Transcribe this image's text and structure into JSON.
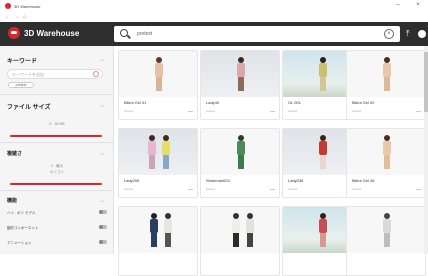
{
  "window": {
    "title": "3D Warehouse",
    "nav_back": "←",
    "nav_forward": "→",
    "nav_home": "⌂",
    "minimize": "–",
    "close": "×"
  },
  "header": {
    "brand": "3D Warehouse",
    "search_value": "pretext",
    "clear": "×",
    "upload_icon": "⤒"
  },
  "sidebar": {
    "keyword_heading": "キーワード",
    "keyword_placeholder": "キーワードを追加",
    "keyword_chip": "pretext",
    "filesize_heading": "ファイル サイズ",
    "filesize_range": "0 - 30 MB",
    "complexity_heading": "複雑さ",
    "complexity_line1": "0 - 最大",
    "complexity_line2": "ポリゴン",
    "features_heading": "機能",
    "toggles": [
      "ハイ - ポリ モデル",
      "動的コンポーネント",
      "アニメーション"
    ]
  },
  "models": [
    {
      "name": "Bikini Girl 01",
      "meta": "pretext"
    },
    {
      "name": "Lady40",
      "meta": "pretext"
    },
    {
      "name": "OL 001",
      "meta": "pretext"
    },
    {
      "name": "Bikini Girl 02",
      "meta": "pretext"
    },
    {
      "name": "Lady205",
      "meta": "pretext"
    },
    {
      "name": "Workman003",
      "meta": "pretext"
    },
    {
      "name": "Lady038",
      "meta": "pretext"
    },
    {
      "name": "Bikini Girl 46",
      "meta": "pretext"
    },
    {
      "name": "",
      "meta": ""
    },
    {
      "name": "",
      "meta": ""
    },
    {
      "name": "",
      "meta": ""
    },
    {
      "name": "",
      "meta": ""
    }
  ],
  "colors": {
    "accent": "#d8262b",
    "header_bg": "#2e2e2e",
    "sidebar_bg": "#f5f5f5"
  }
}
